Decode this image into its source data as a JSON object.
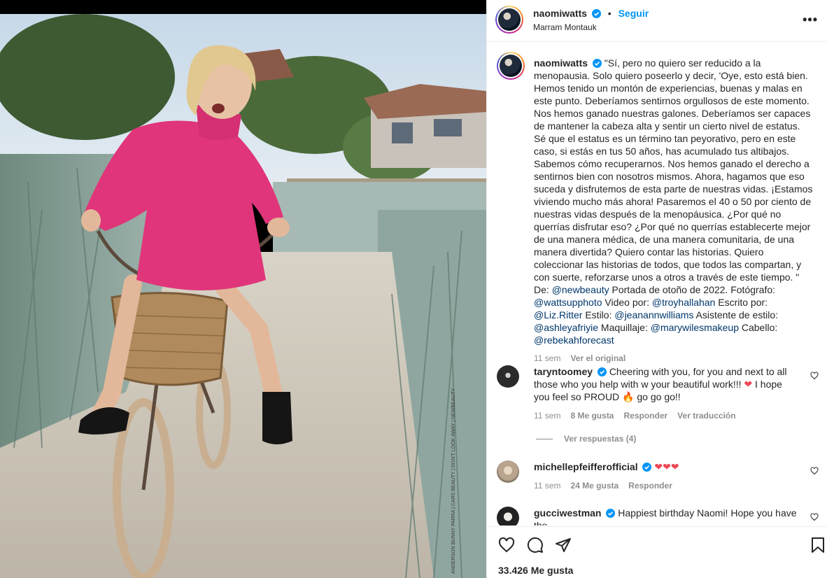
{
  "post": {
    "author": "naomiwatts",
    "follow_label": "Seguir",
    "separator": "•",
    "location": "Marram Montauk",
    "more_label": "•••",
    "photo_credit": "ANDERSON BUNNY PARRA | CARS BEAUTY | DON'T LOOK AWAY | NEWBEAUTY"
  },
  "caption": {
    "username": "naomiwatts",
    "text_main": "\"Sí, pero no quiero ser reducido a la menopausia. Solo quiero poseerlo y decir, 'Oye, esto está bien. Hemos tenido un montón de experiencias, buenas y malas en este punto. Deberíamos sentirnos orgullosos de este momento. Nos hemos ganado nuestras galones. Deberíamos ser capaces de mantener la cabeza alta y sentir un cierto nivel de estatus. Sé que el estatus es un término tan peyorativo, pero en este caso, si estás en tus 50 años, has acumulado tus altibajos. Sabemos cómo recuperarnos. Nos hemos ganado el derecho a sentirnos bien con nosotros mismos. Ahora, hagamos que eso suceda y disfrutemos de esta parte de nuestras vidas. ¡Estamos viviendo mucho más ahora! Pasaremos el 40 o 50 por ciento de nuestras vidas después de la menopáusica. ¿Por qué no querrías disfrutar eso? ¿Por qué no querrías establecerte mejor de una manera médica, de una manera comunitaria, de una manera divertida? Quiero contar las historias. Quiero coleccionar las historias de todos, que todos las compartan, y con suerte, reforzarse unos a otros a través de este tiempo. \" De: ",
    "m1": "@newbeauty",
    "t1": " Portada de otoño de 2022. Fotógrafo: ",
    "m2": "@wattsupphoto",
    "t2": " Video por: ",
    "m3": "@troyhallahan",
    "t3": " Escrito por: ",
    "m4": "@Liz.Ritter",
    "t4": " Estilo: ",
    "m5": "@jeanannwilliams",
    "t5": " Asistente de estilo: ",
    "m6": "@ashleyafriyie",
    "t6": " Maquillaje: ",
    "m7": "@marywilesmakeup",
    "t7": " Cabello: ",
    "m8": "@rebekahforecast",
    "time": "11 sem",
    "see_original": "Ver el original"
  },
  "comments": [
    {
      "username": "taryntoomey",
      "text_a": "Cheering with you, for you and next to all those who you help with w your beautiful work!!! ",
      "emoji_a": "❤",
      "text_b": " I hope you feel so PROUD ",
      "emoji_b": "🔥",
      "text_c": " go go go!!",
      "time": "11 sem",
      "likes": "8 Me gusta",
      "reply": "Responder",
      "translate": "Ver traducción",
      "view_replies": "Ver respuestas (4)"
    },
    {
      "username": "michellepfeifferofficial",
      "text": "❤❤❤",
      "time": "11 sem",
      "likes": "24 Me gusta",
      "reply": "Responder"
    },
    {
      "username": "gucciwestman",
      "text": "Happiest birthday Naomi! Hope you have the"
    }
  ],
  "actions": {
    "likes_count": "33.426 Me gusta"
  },
  "colors": {
    "accent_blue": "#0095f6",
    "mention": "#00376b",
    "heart_red": "#ed4956",
    "muted": "#8e8e8e"
  },
  "icons": [
    "verified-badge-icon",
    "more-options-icon",
    "heart-icon",
    "comment-icon",
    "share-icon",
    "bookmark-icon"
  ]
}
